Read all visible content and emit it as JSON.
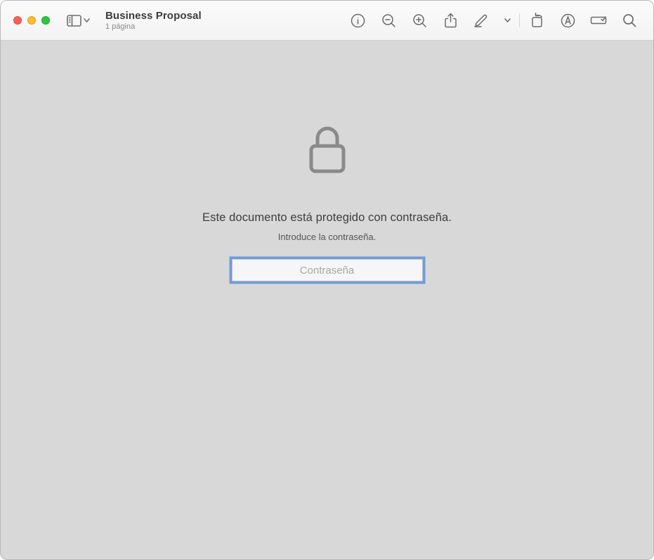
{
  "header": {
    "title": "Business Proposal",
    "subtitle": "1 página"
  },
  "toolbar": {
    "icons": {
      "sidebar": "sidebar-icon",
      "sidebar_chevron": "chevron-down-icon",
      "info": "info-icon",
      "zoom_out": "zoom-out-icon",
      "zoom_in": "zoom-in-icon",
      "share": "share-icon",
      "highlight": "highlight-icon",
      "highlight_chevron": "chevron-down-icon",
      "rotate": "rotate-icon",
      "markup": "markup-icon",
      "form": "form-field-icon",
      "search": "search-icon"
    }
  },
  "locked": {
    "title": "Este documento está protegido con contraseña.",
    "subtitle": "Introduce la contraseña.",
    "placeholder": "Contraseña",
    "value": ""
  }
}
